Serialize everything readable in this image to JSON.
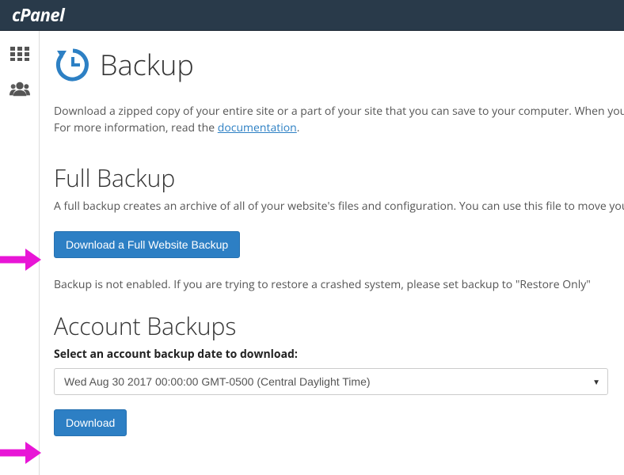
{
  "header": {
    "logo": "cPanel"
  },
  "page": {
    "title": "Backup",
    "intro_line1": "Download a zipped copy of your entire site or a part of your site that you can save to your computer. When you",
    "intro_line2_prefix": "For more information, read the ",
    "doc_link_text": "documentation",
    "intro_line2_suffix": "."
  },
  "full_backup": {
    "heading": "Full Backup",
    "description": "A full backup creates an archive of all of your website's files and configuration. You can use this file to move you",
    "button_label": "Download a Full Website Backup",
    "warning": "Backup is not enabled. If you are trying to restore a crashed system, please set backup to \"Restore Only\""
  },
  "account_backups": {
    "heading": "Account Backups",
    "field_label": "Select an account backup date to download:",
    "selected_option": "Wed Aug 30 2017 00:00:00 GMT-0500 (Central Daylight Time)",
    "download_label": "Download"
  }
}
